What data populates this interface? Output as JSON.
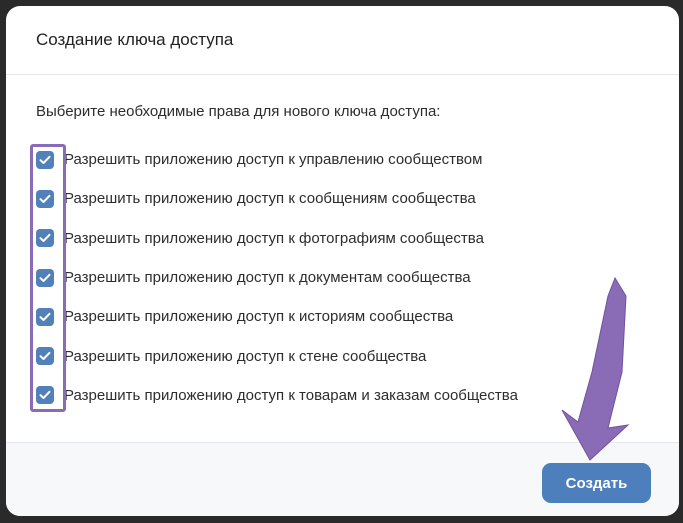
{
  "dialog": {
    "title": "Создание ключа доступа",
    "subtitle": "Выберите необходимые права для нового ключа доступа:",
    "permissions": [
      {
        "label": "Разрешить приложению доступ к управлению сообществом",
        "checked": true
      },
      {
        "label": "Разрешить приложению доступ к сообщениям сообщества",
        "checked": true
      },
      {
        "label": "Разрешить приложению доступ к фотографиям сообщества",
        "checked": true
      },
      {
        "label": "Разрешить приложению доступ к документам сообщества",
        "checked": true
      },
      {
        "label": "Разрешить приложению доступ к историям сообщества",
        "checked": true
      },
      {
        "label": "Разрешить приложению доступ к стене сообщества",
        "checked": true
      },
      {
        "label": "Разрешить приложению доступ к товарам и заказам сообщества",
        "checked": true
      }
    ],
    "create_label": "Создать"
  },
  "colors": {
    "accent": "#4d7fbd",
    "checkbox": "#5181b8",
    "annotation": "#8a6bb5"
  },
  "icons": {
    "checkbox": "check-icon",
    "annotation_arrow": "arrow-down-icon"
  }
}
